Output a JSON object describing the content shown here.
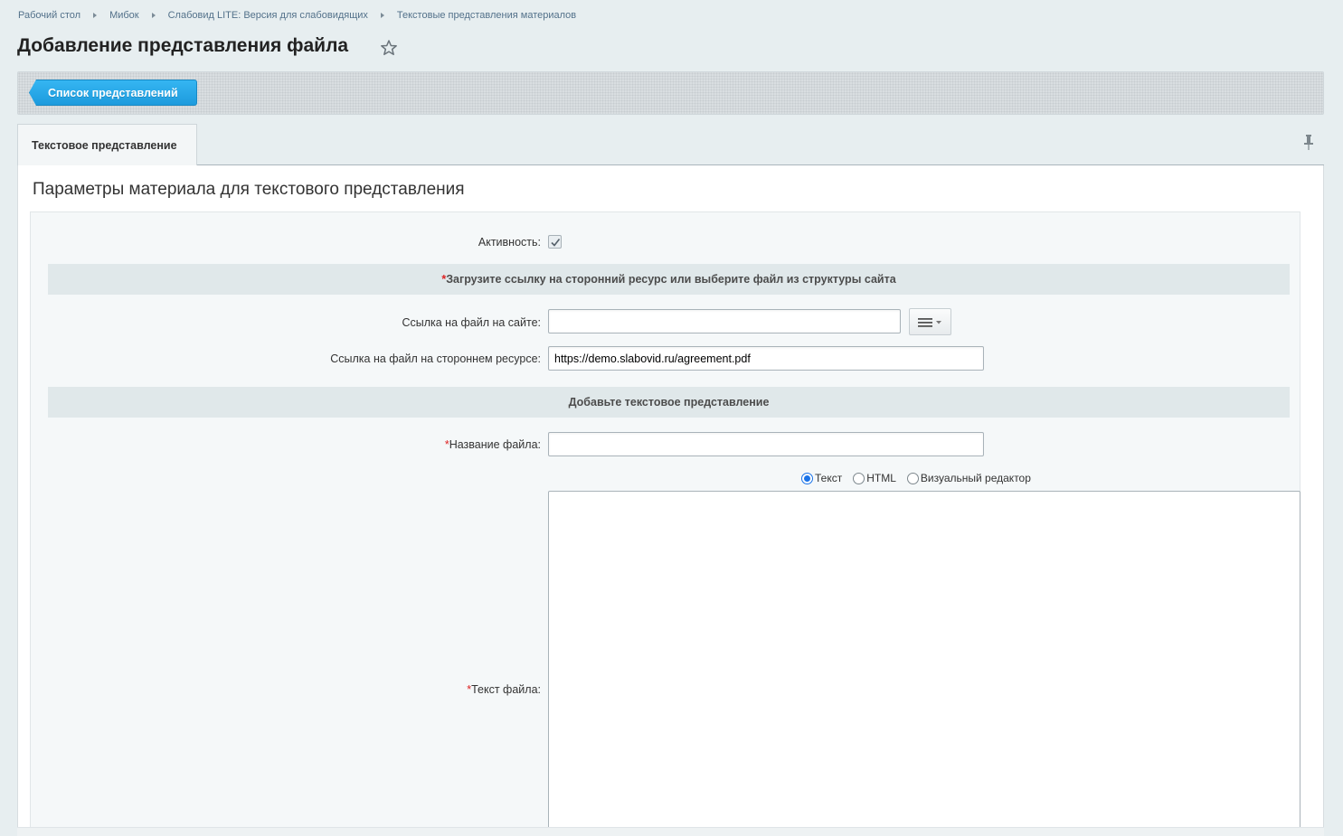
{
  "breadcrumb": [
    "Рабочий стол",
    "Мибок",
    "Слабовид LITE: Версия для слабовидящих",
    "Текстовые представления материалов"
  ],
  "page": {
    "title": "Добавление представления файла"
  },
  "toolbar": {
    "list_button": "Список представлений"
  },
  "tabs": {
    "active": "Текстовое представление"
  },
  "form": {
    "section_title": "Параметры материала для текстового представления",
    "active_label": "Активность:",
    "active_checked": true,
    "group1_required_mark": "*",
    "group1_header": "Загрузите ссылку на сторонний ресурс или выберите файл из структуры сайта",
    "site_file_label": "Ссылка на файл на сайте:",
    "site_file_value": "",
    "external_file_label": "Ссылка на файл на стороннем ресурсе:",
    "external_file_value": "https://demo.slabovid.ru/agreement.pdf",
    "group2_header": "Добавьте текстовое представление",
    "file_name_required_mark": "*",
    "file_name_label": "Название файла:",
    "file_name_value": "",
    "editor_modes": [
      "Текст",
      "HTML",
      "Визуальный редактор"
    ],
    "editor_mode_selected": "Текст",
    "file_text_required_mark": "*",
    "file_text_label": "Текст файла:",
    "file_text_value": ""
  },
  "colors": {
    "primary_button": "#2aa9ea",
    "required": "#dd2222",
    "background": "#e7eef0"
  }
}
